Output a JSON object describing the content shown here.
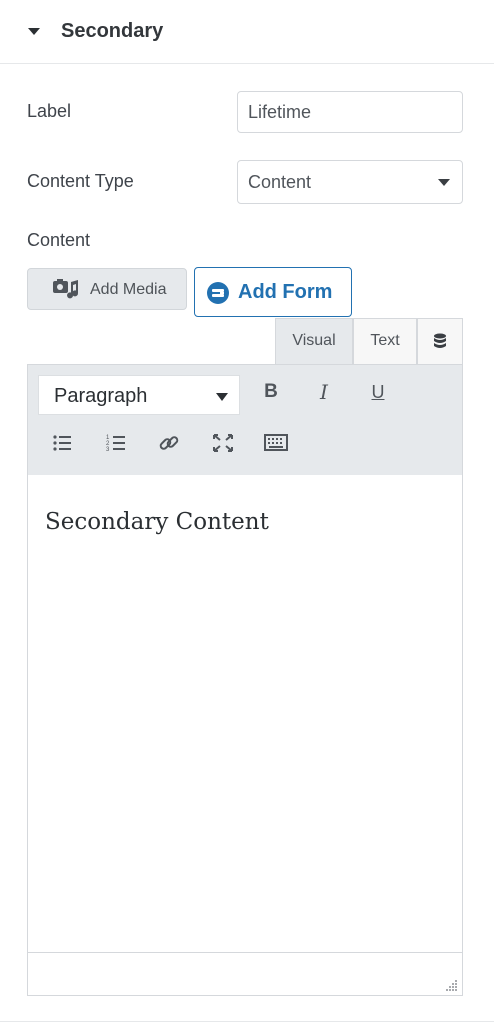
{
  "section": {
    "title": "Secondary"
  },
  "fields": {
    "label": {
      "label": "Label",
      "value": "Lifetime"
    },
    "content_type": {
      "label": "Content Type",
      "selected": "Content"
    },
    "content": {
      "label": "Content"
    }
  },
  "media_buttons": {
    "add_media": "Add Media",
    "add_form": "Add Form"
  },
  "editor_tabs": {
    "visual": "Visual",
    "text": "Text"
  },
  "toolbar": {
    "format_selected": "Paragraph",
    "bold": "B",
    "italic": "I",
    "underline": "U"
  },
  "editor": {
    "body_text": "Secondary Content"
  },
  "colors": {
    "accent": "#2271b1",
    "toolbar_bg": "#e6e9ec",
    "border": "#d5d8dc"
  }
}
